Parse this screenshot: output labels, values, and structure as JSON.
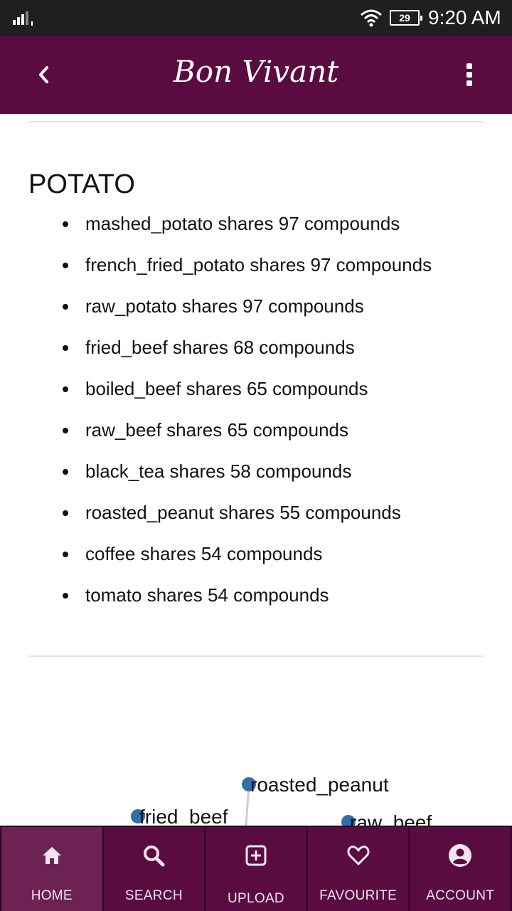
{
  "status_bar": {
    "time": "9:20 AM",
    "battery": "29"
  },
  "app_bar": {
    "title": "Bon Vivant"
  },
  "section": {
    "title": "POTATO",
    "items": [
      "mashed_potato shares 97 compounds",
      "french_fried_potato shares 97 compounds",
      "raw_potato shares 97 compounds",
      "fried_beef shares 68 compounds",
      "boiled_beef shares 65 compounds",
      "raw_beef shares 65 compounds",
      "black_tea shares 58 compounds",
      "roasted_peanut shares 55 compounds",
      "coffee shares 54 compounds",
      "tomato shares 54 compounds"
    ]
  },
  "graph": {
    "node_color": "#2f6fb0",
    "nodes": [
      "roasted_peanut",
      "fried_beef",
      "raw_beef"
    ]
  },
  "bottom_nav": {
    "items": [
      "HOME",
      "SEARCH",
      "UPLOAD",
      "FAVOURITE",
      "ACCOUNT"
    ]
  },
  "colors": {
    "brand": "#5a0c40",
    "active_tab": "#6d2254",
    "status_bar": "#1f1f1f"
  }
}
